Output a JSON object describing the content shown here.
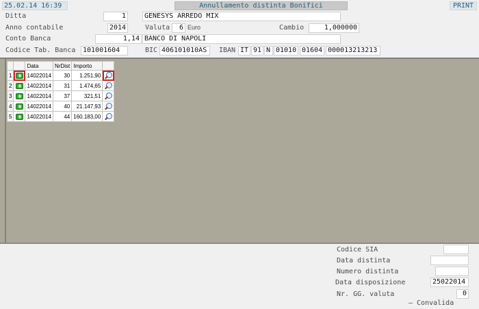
{
  "top": {
    "timestamp": "25.02.14 16:39",
    "title": "Annullamento distinta Bonifici",
    "print": "PRINT"
  },
  "header": {
    "ditta_label": "Ditta",
    "ditta_code": "1",
    "ditta_name": "GENESYS ARREDO MIX",
    "anno_label": "Anno contabile",
    "anno_value": "2014",
    "valuta_label": "Valuta",
    "valuta_code": "6",
    "valuta_name": "Euro",
    "cambio_label": "Cambio",
    "cambio_value": "1,000000",
    "conto_label": "Conto Banca",
    "conto_code": "1,14",
    "conto_name": "BANCO DI NAPOLI",
    "codice_label": "Codice Tab. Banca",
    "codice_value": "101001604",
    "bic_label": "BIC",
    "bic_value": "406101010AS",
    "iban_label": "IBAN",
    "iban_country": "IT",
    "iban_check": "91",
    "iban_cin": "N",
    "iban_abi": "01010",
    "iban_cab": "01604",
    "iban_account": "000013213213"
  },
  "grid": {
    "columns": [
      "Data",
      "NrDist",
      "Importo"
    ],
    "rows": [
      {
        "n": "1",
        "data": "14022014",
        "nr": "30",
        "importo": "1.251,90"
      },
      {
        "n": "2",
        "data": "14022014",
        "nr": "31",
        "importo": "1.474,65"
      },
      {
        "n": "3",
        "data": "14022014",
        "nr": "37",
        "importo": "321,51"
      },
      {
        "n": "4",
        "data": "14022014",
        "nr": "40",
        "importo": "21.147,93"
      },
      {
        "n": "5",
        "data": "14022014",
        "nr": "44",
        "importo": "160.183,00"
      }
    ]
  },
  "footer": {
    "sia_label": "Codice SIA",
    "sia_value": "",
    "data_distinta_label": "Data   distinta",
    "data_distinta_value": "",
    "numero_distinta_label": "Numero distinta",
    "numero_distinta_value": "",
    "data_disposizione_label": "Data disposizione",
    "data_disposizione_value": "25022014",
    "nr_gg_label": "Nr. GG. valuta",
    "nr_gg_value": "0",
    "convalida_label": "— Convalida"
  },
  "icons": {
    "row_action": "money-icon",
    "row_detail": "magnifier-icon"
  }
}
